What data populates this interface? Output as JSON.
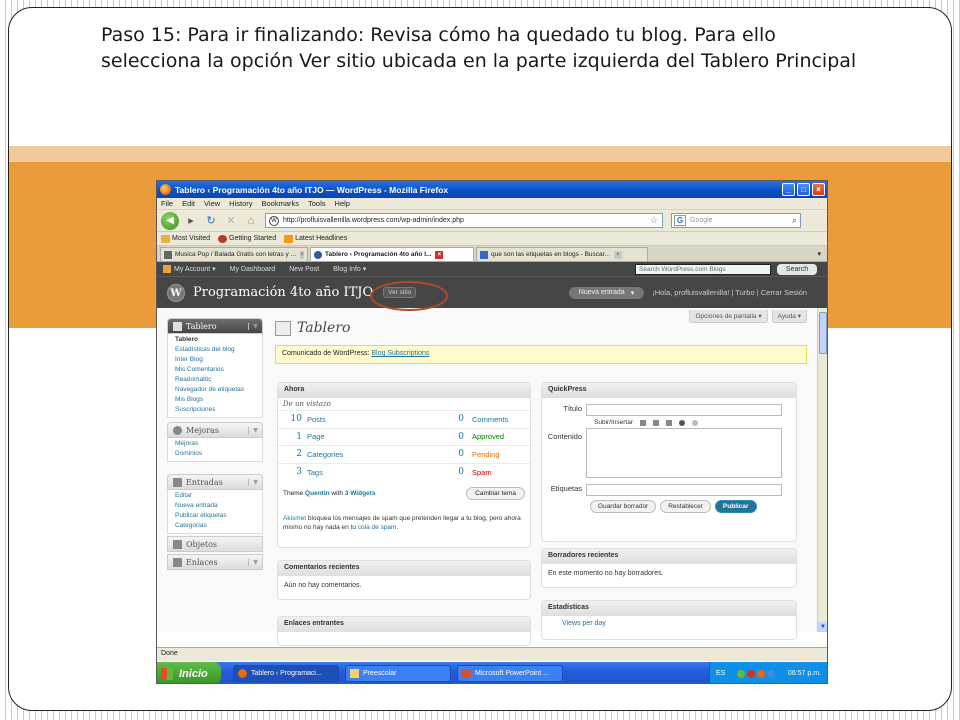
{
  "slide": {
    "text": "Paso 15: Para ir finalizando: Revisa cómo ha quedado tu blog. Para ello selecciona la opción Ver sitio ubicada en la parte izquierda del Tablero Principal"
  },
  "colors": {
    "orange_band": "#ea9b3a",
    "wp_dark": "#464646",
    "wp_link": "#21759b",
    "highlight_oval": "#b04b2c"
  },
  "browser": {
    "window_title": "Tablero ‹ Programación 4to año ITJO — WordPress - Mozilla Firefox",
    "menu": [
      "File",
      "Edit",
      "View",
      "History",
      "Bookmarks",
      "Tools",
      "Help"
    ],
    "url": "http://profluisvallenilla.wordpress.com/wp-admin/index.php",
    "search_placeholder": "Google",
    "bookmarks": [
      "Most Visited",
      "Getting Started",
      "Latest Headlines"
    ],
    "tabs": [
      {
        "label": "Musica Pop / Balada Gratis con letras y ..."
      },
      {
        "label": "Tablero ‹ Programación 4to año I..."
      },
      {
        "label": "que son las etiquetas en blogs - Buscar..."
      }
    ],
    "status": "Done"
  },
  "admin_bar": {
    "items": [
      "My Account ▾",
      "My Dashboard",
      "New Post",
      "Blog Info ▾"
    ],
    "search_placeholder": "Search WordPress.com Blogs",
    "search_button": "Search"
  },
  "header": {
    "blog_name": "Programación 4to año ITJO",
    "ver_sitio": "Ver sitio",
    "nueva_entrada": "Nueva entrada",
    "greeting": "¡Hola, profluisvallenilla! | Turbo | Cerrar Sesión"
  },
  "screen_options": [
    "Opciones de pantalla ▾",
    "Ayuda ▾"
  ],
  "sidebar": {
    "tablero": {
      "label": "Tablero",
      "items": [
        "Tablero",
        "Estadísticas del blog",
        "Inter Blog",
        "Mis Comentarios",
        "Readomattic",
        "Navegador de etiquetas",
        "Mis Blogs",
        "Suscripciones"
      ]
    },
    "mejoras": {
      "label": "Mejoras",
      "items": [
        "Mejoras",
        "Dominios"
      ]
    },
    "entradas": {
      "label": "Entradas",
      "items": [
        "Editar",
        "Nueva entrada",
        "Publicar etiquetas",
        "Categorías"
      ]
    },
    "objetos": {
      "label": "Objetos"
    },
    "enlaces": {
      "label": "Enlaces"
    }
  },
  "page_title": "Tablero",
  "notice": {
    "prefix": "Comunicado de WordPress:",
    "link": "Blog Subscriptions"
  },
  "ahora": {
    "title": "Ahora",
    "subtitle": "De un vistazo",
    "rows": [
      {
        "lnum": "10",
        "llabel": "Posts",
        "rnum": "0",
        "rlabel": "Comments",
        "rcolor": "#21759b"
      },
      {
        "lnum": "1",
        "llabel": "Page",
        "rnum": "0",
        "rlabel": "Approved",
        "rcolor": "#008000"
      },
      {
        "lnum": "2",
        "llabel": "Categories",
        "rnum": "0",
        "rlabel": "Pending",
        "rcolor": "#e66f00"
      },
      {
        "lnum": "3",
        "llabel": "Tags",
        "rnum": "0",
        "rlabel": "Spam",
        "rcolor": "#cc0000"
      }
    ],
    "theme_prefix": "Theme",
    "theme_name": "Quentin",
    "theme_with": "with",
    "widgets": "3 Widgets",
    "change_theme": "Cambiar tema",
    "akismet_name": "Akismet",
    "akismet_text": " bloquea los mensajes de spam que pretenden llegar a tu blog, pero ahora mismo no hay nada en tu ",
    "akismet_link": "cola de spam",
    "akismet_end": "."
  },
  "quickpress": {
    "title": "QuickPress",
    "titulo_label": "Título",
    "upload_label": "Subir/Insertar",
    "contenido_label": "Contenido",
    "etiquetas_label": "Etiquetas",
    "save_draft": "Guardar borrador",
    "reset": "Restablecer",
    "publish": "Publicar"
  },
  "comentarios": {
    "title": "Comentarios recientes",
    "text": "Aún no hay comentarios."
  },
  "borradores": {
    "title": "Borradores recientes",
    "text": "En este momento no hay borradores."
  },
  "enlaces_entrantes": {
    "title": "Enlaces entrantes"
  },
  "estadisticas": {
    "title": "Estadísticas",
    "views": "Views per day"
  },
  "taskbar": {
    "start": "Inicio",
    "tasks": [
      "Tablero ‹ Programaci...",
      "Preescolar",
      "Microsoft PowerPoint ..."
    ],
    "lang": "ES",
    "clock": "06:57 p.m."
  }
}
